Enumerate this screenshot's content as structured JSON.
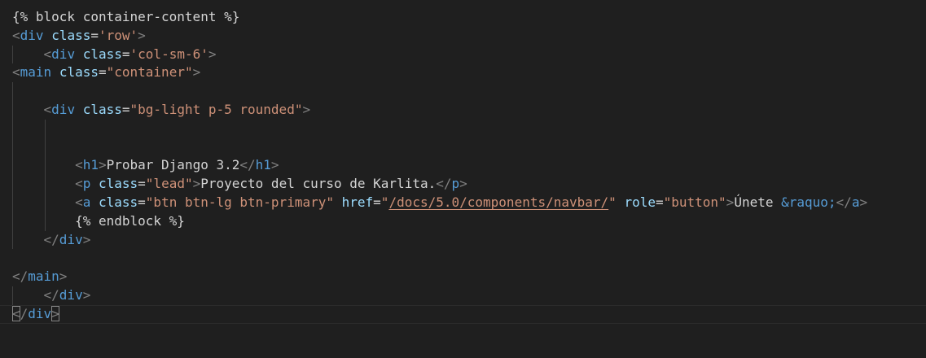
{
  "editor": {
    "language": "html-django",
    "colors": {
      "background": "#1f1f1f",
      "text": "#d4d4d4",
      "tag": "#569cd6",
      "attribute": "#9cdcfe",
      "string": "#ce9178",
      "punctuation": "#808080"
    },
    "lines": [
      {
        "indent": 0,
        "guides": 0,
        "tokens": [
          {
            "t": "text",
            "v": "{% block container-content %}"
          }
        ]
      },
      {
        "indent": 0,
        "guides": 0,
        "tokens": [
          {
            "t": "punct",
            "v": "<"
          },
          {
            "t": "tag",
            "v": "div"
          },
          {
            "t": "text",
            "v": " "
          },
          {
            "t": "attr",
            "v": "class"
          },
          {
            "t": "text",
            "v": "="
          },
          {
            "t": "str",
            "v": "'row'"
          },
          {
            "t": "punct",
            "v": ">"
          }
        ]
      },
      {
        "indent": 1,
        "guides": 1,
        "tokens": [
          {
            "t": "punct",
            "v": "<"
          },
          {
            "t": "tag",
            "v": "div"
          },
          {
            "t": "text",
            "v": " "
          },
          {
            "t": "attr",
            "v": "class"
          },
          {
            "t": "text",
            "v": "="
          },
          {
            "t": "str",
            "v": "'col-sm-6'"
          },
          {
            "t": "punct",
            "v": ">"
          }
        ]
      },
      {
        "indent": 0,
        "guides": 0,
        "tokens": [
          {
            "t": "punct",
            "v": "<"
          },
          {
            "t": "tag",
            "v": "main"
          },
          {
            "t": "text",
            "v": " "
          },
          {
            "t": "attr",
            "v": "class"
          },
          {
            "t": "text",
            "v": "="
          },
          {
            "t": "str",
            "v": "\"container\""
          },
          {
            "t": "punct",
            "v": ">"
          }
        ]
      },
      {
        "indent": 0,
        "guides": 1,
        "tokens": []
      },
      {
        "indent": 1,
        "guides": 1,
        "tokens": [
          {
            "t": "punct",
            "v": "<"
          },
          {
            "t": "tag",
            "v": "div"
          },
          {
            "t": "text",
            "v": " "
          },
          {
            "t": "attr",
            "v": "class"
          },
          {
            "t": "text",
            "v": "="
          },
          {
            "t": "str",
            "v": "\"bg-light p-5 rounded\""
          },
          {
            "t": "punct",
            "v": ">"
          }
        ]
      },
      {
        "indent": 0,
        "guides": 2,
        "tokens": []
      },
      {
        "indent": 0,
        "guides": 2,
        "tokens": []
      },
      {
        "indent": 2,
        "guides": 2,
        "tokens": [
          {
            "t": "punct",
            "v": "<"
          },
          {
            "t": "tag",
            "v": "h1"
          },
          {
            "t": "punct",
            "v": ">"
          },
          {
            "t": "text",
            "v": "Probar Django 3.2"
          },
          {
            "t": "punct",
            "v": "</"
          },
          {
            "t": "tag",
            "v": "h1"
          },
          {
            "t": "punct",
            "v": ">"
          }
        ]
      },
      {
        "indent": 2,
        "guides": 2,
        "tokens": [
          {
            "t": "punct",
            "v": "<"
          },
          {
            "t": "tag",
            "v": "p"
          },
          {
            "t": "text",
            "v": " "
          },
          {
            "t": "attr",
            "v": "class"
          },
          {
            "t": "text",
            "v": "="
          },
          {
            "t": "str",
            "v": "\"lead\""
          },
          {
            "t": "punct",
            "v": ">"
          },
          {
            "t": "text",
            "v": "Proyecto del curso de Karlita."
          },
          {
            "t": "punct",
            "v": "</"
          },
          {
            "t": "tag",
            "v": "p"
          },
          {
            "t": "punct",
            "v": ">"
          }
        ]
      },
      {
        "indent": 2,
        "guides": 2,
        "tokens": [
          {
            "t": "punct",
            "v": "<"
          },
          {
            "t": "tag",
            "v": "a"
          },
          {
            "t": "text",
            "v": " "
          },
          {
            "t": "attr",
            "v": "class"
          },
          {
            "t": "text",
            "v": "="
          },
          {
            "t": "str",
            "v": "\"btn btn-lg btn-primary\""
          },
          {
            "t": "text",
            "v": " "
          },
          {
            "t": "attr",
            "v": "href"
          },
          {
            "t": "text",
            "v": "="
          },
          {
            "t": "str",
            "v": "\""
          },
          {
            "t": "link",
            "v": "/docs/5.0/components/navbar/"
          },
          {
            "t": "str",
            "v": "\""
          },
          {
            "t": "text",
            "v": " "
          },
          {
            "t": "attr",
            "v": "role"
          },
          {
            "t": "text",
            "v": "="
          },
          {
            "t": "str",
            "v": "\"button\""
          },
          {
            "t": "punct",
            "v": ">"
          },
          {
            "t": "text",
            "v": "Únete "
          },
          {
            "t": "entity",
            "v": "&raquo;"
          },
          {
            "t": "punct",
            "v": "</"
          },
          {
            "t": "tag",
            "v": "a"
          },
          {
            "t": "punct",
            "v": ">"
          }
        ]
      },
      {
        "indent": 2,
        "guides": 2,
        "tokens": [
          {
            "t": "text",
            "v": "{% endblock %}"
          }
        ]
      },
      {
        "indent": 1,
        "guides": 1,
        "tokens": [
          {
            "t": "punct",
            "v": "</"
          },
          {
            "t": "tag",
            "v": "div"
          },
          {
            "t": "punct",
            "v": ">"
          }
        ]
      },
      {
        "indent": 0,
        "guides": 0,
        "tokens": []
      },
      {
        "indent": 0,
        "guides": 0,
        "tokens": [
          {
            "t": "punct",
            "v": "</"
          },
          {
            "t": "tag",
            "v": "main"
          },
          {
            "t": "punct",
            "v": ">"
          }
        ]
      },
      {
        "indent": 1,
        "guides": 1,
        "tokens": [
          {
            "t": "punct",
            "v": "</"
          },
          {
            "t": "tag",
            "v": "div"
          },
          {
            "t": "punct",
            "v": ">"
          }
        ]
      },
      {
        "indent": 0,
        "guides": 0,
        "current": true,
        "tokens": [
          {
            "t": "punct",
            "v": "<",
            "match": true
          },
          {
            "t": "punct",
            "v": "/"
          },
          {
            "t": "tag",
            "v": "div"
          },
          {
            "t": "punct",
            "v": ">",
            "match": true
          }
        ]
      }
    ]
  }
}
